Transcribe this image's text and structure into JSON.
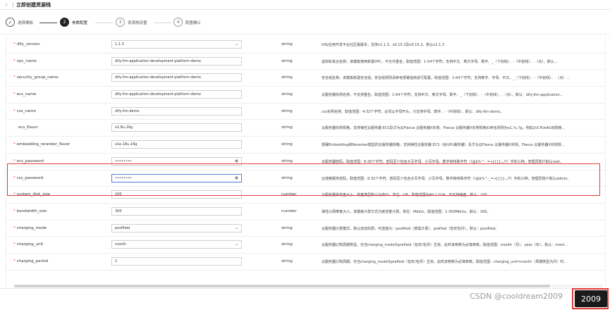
{
  "header": {
    "back_icon": "back-arrow-icon",
    "title": "立即创建资源栈"
  },
  "steps": [
    {
      "num": "✓",
      "label": "选择模板",
      "state": "done"
    },
    {
      "num": "2",
      "label": "参数配置",
      "state": "active"
    },
    {
      "num": "3",
      "label": "资源栈设置",
      "state": "pending"
    },
    {
      "num": "4",
      "label": "配置确认",
      "state": "pending"
    }
  ],
  "params": [
    {
      "name": "dify_version",
      "required": true,
      "value": "1.1.3",
      "control": "select",
      "type": "string",
      "desc": "Dify应用开发平台社区版版本，支持v1.1.3、v0.15.3及v0.15.2。默认v1.1.3"
    },
    {
      "name": "vpc_name",
      "required": true,
      "value": "dify-llm-application-development-platform-demo",
      "control": "text",
      "type": "string",
      "desc": "虚拟私有云名称，该模板使用新建VPC，不允许重名。取值范围：1-54个字符，支持中文、英文字母、数字、_（下划线）、-（中划线）、.（点）。默认..."
    },
    {
      "name": "security_group_name",
      "required": true,
      "value": "dify-llm-application-development-platform-demo",
      "control": "text",
      "type": "string",
      "desc": "安全组名称，该模板新建安全组，安全组规则请参考部署指南进行配置。取值范围：1-64个字符，支持数字、字母、中文、_（下划线）、-（中划线）、.（点）..."
    },
    {
      "name": "ecs_name",
      "required": true,
      "value": "dify-llm-application-development-platform-demo",
      "control": "text",
      "type": "string",
      "desc": "云服务器实例名称，不支持重名。取值范围：1-64个字符，支持中文、英文字母、数字、_（下划线）、-（中划线）、.（点）。默认：dify-llm-application..."
    },
    {
      "name": "css_name",
      "required": true,
      "value": "dify-llm-demo",
      "control": "text",
      "type": "string",
      "desc": "css实例名称。取值范围：4-32个字符，必须以字母开头，只支持字母、数字、-（中划线）。默认：dify-llm-demo。"
    },
    {
      "name": "ecs_flavor",
      "required": false,
      "value": "x1.8u.16g",
      "control": "text",
      "type": "string",
      "desc": "云服务器实例规格，支持弹性云服务器 ECS及华为云Flexus 云服务器X实例。Flexus 云服务器X实例规格ID命名规则为x1.?u.?g，例如2vCPUs4GiB规格..."
    },
    {
      "name": "embedding_reranker_flavor",
      "required": true,
      "value": "x1e.16u.16g",
      "control": "text",
      "type": "string",
      "desc": "部署Embedding和Reranker模型的云服务器规格，支持弹性云服务器 ECS（含GPU服务器）及华为云Flexus 云服务器X实例。Flexus 云服务器X实例规..."
    },
    {
      "name": "ecs_password",
      "required": true,
      "value": "••••••••",
      "control": "password",
      "type": "string",
      "desc": "云服务器密码，取值范围：8-26个字符，密码至少包含大写字母、小写字母、数字和特殊字符（!@$%^-_=+[{}]:,./?）中的三种。管理员账户默认root。"
    },
    {
      "name": "css_password",
      "required": true,
      "value": "••••••••",
      "control": "password-focus",
      "type": "string",
      "desc": "云搜索服务密码，取值范围：8-32个字符，密码至少包含大写字母、小写字母、数字和特殊字符（!@$%^-_=+[{}]:,./?）中的三种。管理员账户默认admin。"
    },
    {
      "name": "system_disk_size",
      "required": true,
      "value": "100",
      "control": "text",
      "type": "number",
      "desc": "云服务器系统盘大小，磁盘类型默认为高IO，单位：GB，取值范围为40-1,024，不支持缩盘。默认：100"
    },
    {
      "name": "bandwidth_size",
      "required": true,
      "value": "300",
      "control": "text",
      "type": "number",
      "desc": "弹性公网带宽大小，该模板计费方式为按流量计费。单位：Mbit/s，取值范围：1-300Mbit/s，默认：300。"
    },
    {
      "name": "charging_mode",
      "required": true,
      "value": "postPaid",
      "control": "select",
      "type": "string",
      "desc": "云服务器计费模式，默认自动扣费，可选值为：postPaid（按需计费）、prePaid（包年包月），默认：postPaid。"
    },
    {
      "name": "charging_unit",
      "required": true,
      "value": "month",
      "control": "select",
      "type": "string",
      "desc": "云服务器订购周期类型，仅当charging_mode为prePaid（包年/包月）生效，此时该参数为必填参数。取值范围：month（月）、year（年）。默认：mont..."
    },
    {
      "name": "charging_period",
      "required": true,
      "value": "1",
      "control": "text",
      "type": "string",
      "desc": "云服务器订购周期，仅当charging_mode为prePaid（包年/包月）生效，此时该参数为必填参数。取值范围：charging_unit=month（周期类型为月）时..."
    }
  ],
  "footer": {
    "watermark": "CSDN @cooldream2009",
    "next_label": "2009"
  },
  "colors": {
    "required": "#e43c3c",
    "highlight_box": "#e23b3b",
    "active_step": "#222222"
  }
}
